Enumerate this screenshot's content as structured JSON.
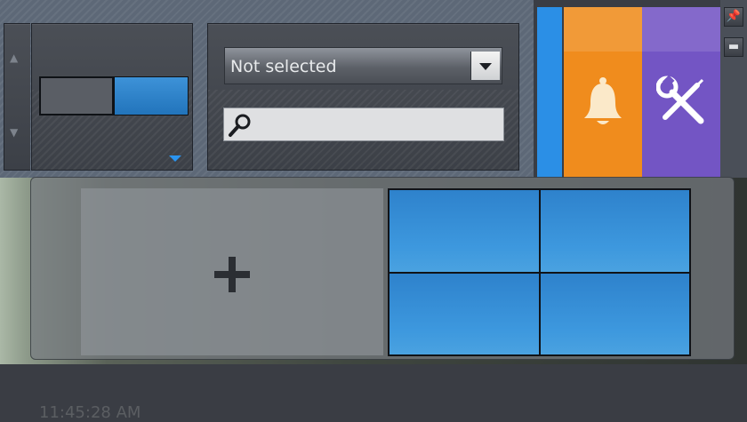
{
  "toolbar": {
    "scroll_up_glyph": "▲",
    "scroll_down_glyph": "▼",
    "camera_select": {
      "value": "Not selected"
    },
    "search": {
      "placeholder": ""
    },
    "pin_glyph": "📌",
    "minimize_glyph": "▬"
  },
  "tabs": {
    "alarm": {
      "icon": "bell-icon",
      "color": "#f08c1d"
    },
    "settings": {
      "icon": "tools-icon",
      "color": "#7355c4"
    },
    "accent": "#2b8fe6"
  },
  "video": {
    "timestamp": "11:45:28 AM"
  },
  "layout_popup": {
    "add_tile_icon": "plus-icon",
    "grid_layout": {
      "rows": 2,
      "columns": 2
    }
  }
}
